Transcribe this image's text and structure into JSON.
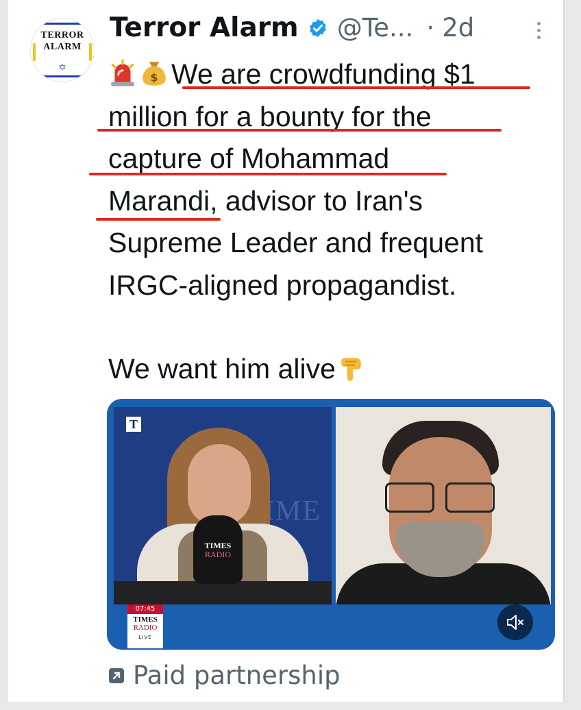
{
  "tweet": {
    "avatar": {
      "logo_line1": "TERROR",
      "logo_line2": "ALARM"
    },
    "author_name": "Terror Alarm",
    "handle": "@Te...",
    "separator": "·",
    "time_ago": "2d",
    "text": {
      "lines": [
        "We are crowdfunding $1",
        "million for a bounty for the",
        "capture of Mohammad",
        "Marandi",
        ", advisor to Iran's",
        "Supreme Leader and frequent",
        "IRGC-aligned propagandist."
      ],
      "second_paragraph": "We want him alive"
    },
    "icons": {
      "verified": "verified-badge-icon",
      "more": "more-options-icon",
      "siren": "police-light-emoji",
      "money_bag": "money-bag-emoji",
      "pointing_down": "backhand-index-pointing-down-emoji",
      "mute": "speaker-muted-icon",
      "partnership": "arrow-up-right-box-icon"
    },
    "media": {
      "channel_badge": "T",
      "background_text": "IME",
      "mic_label_line1": "TIMES",
      "mic_label_line2": "RADIO",
      "lower_third_time": "07:45",
      "lower_third_line1": "TIMES",
      "lower_third_line2": "RADIO",
      "lower_third_line3": "LIVE"
    },
    "footer_label": "Paid partnership"
  },
  "colors": {
    "underline": "#d82c20",
    "verified": "#1d9bf0",
    "muted_text": "#536471",
    "media_frame": "#1b5fb0"
  }
}
